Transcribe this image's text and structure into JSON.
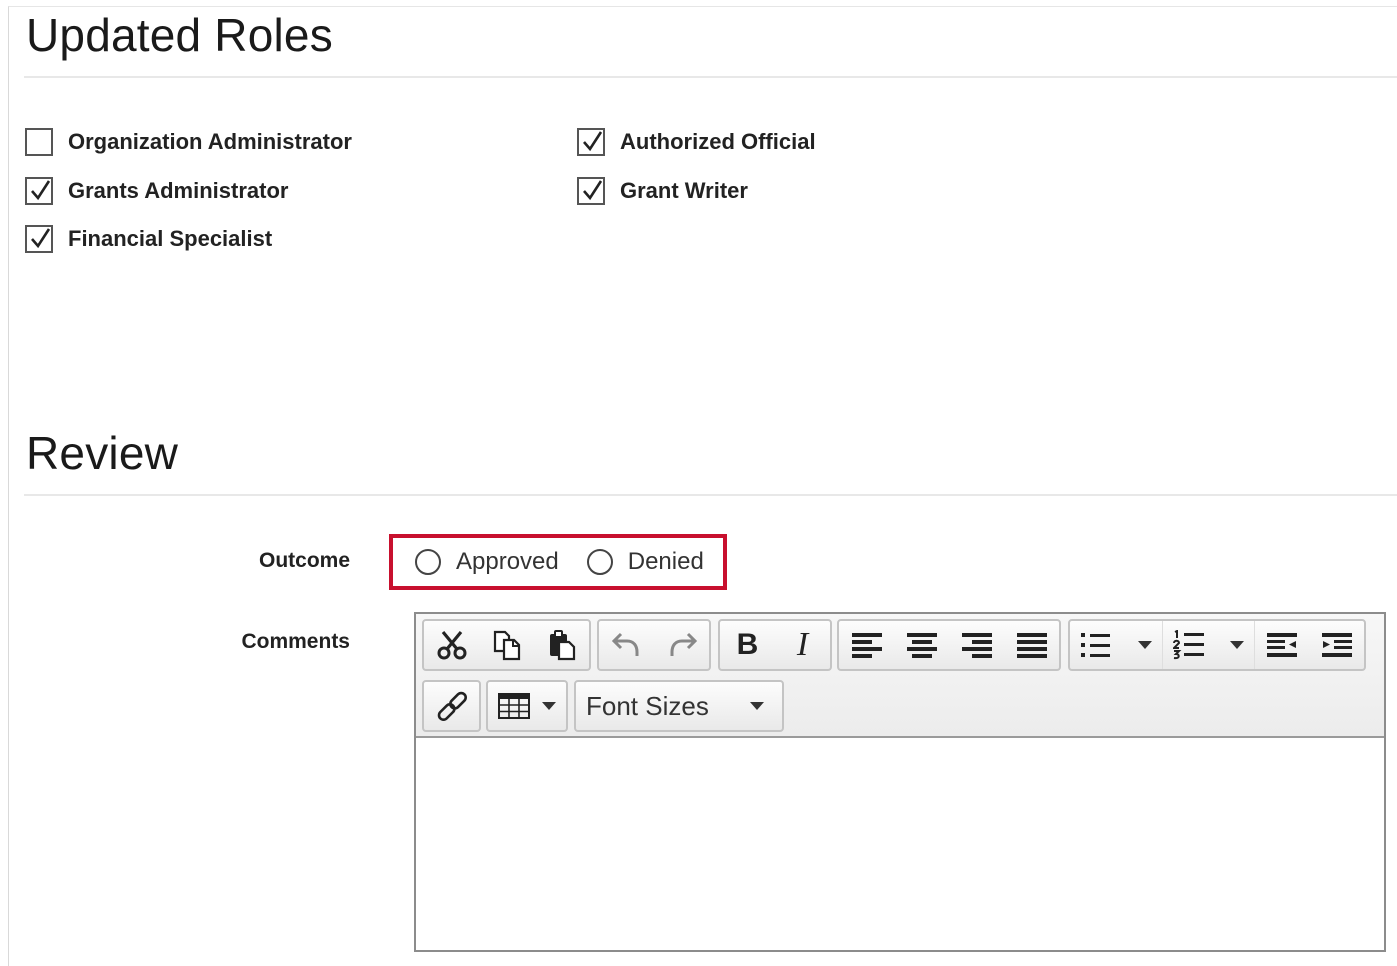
{
  "updated_roles": {
    "title": "Updated Roles",
    "roles": [
      {
        "label": "Organization Administrator",
        "checked": false
      },
      {
        "label": "Grants Administrator",
        "checked": true
      },
      {
        "label": "Financial Specialist",
        "checked": true
      },
      {
        "label": "Authorized Official",
        "checked": true
      },
      {
        "label": "Grant Writer",
        "checked": true
      }
    ]
  },
  "review": {
    "title": "Review",
    "outcome_label": "Outcome",
    "outcome_options": [
      {
        "label": "Approved",
        "selected": false
      },
      {
        "label": "Denied",
        "selected": false
      }
    ],
    "comments_label": "Comments",
    "highlight_color": "#c8102e"
  },
  "editor": {
    "font_sizes_label": "Font Sizes",
    "content": "",
    "toolbar_icons": [
      "cut-icon",
      "copy-icon",
      "paste-icon",
      "undo-icon",
      "redo-icon",
      "bold-icon",
      "italic-icon",
      "align-left-icon",
      "align-center-icon",
      "align-right-icon",
      "align-justify-icon",
      "bullet-list-icon",
      "numbered-list-icon",
      "outdent-icon",
      "indent-icon",
      "link-icon",
      "table-icon"
    ]
  }
}
